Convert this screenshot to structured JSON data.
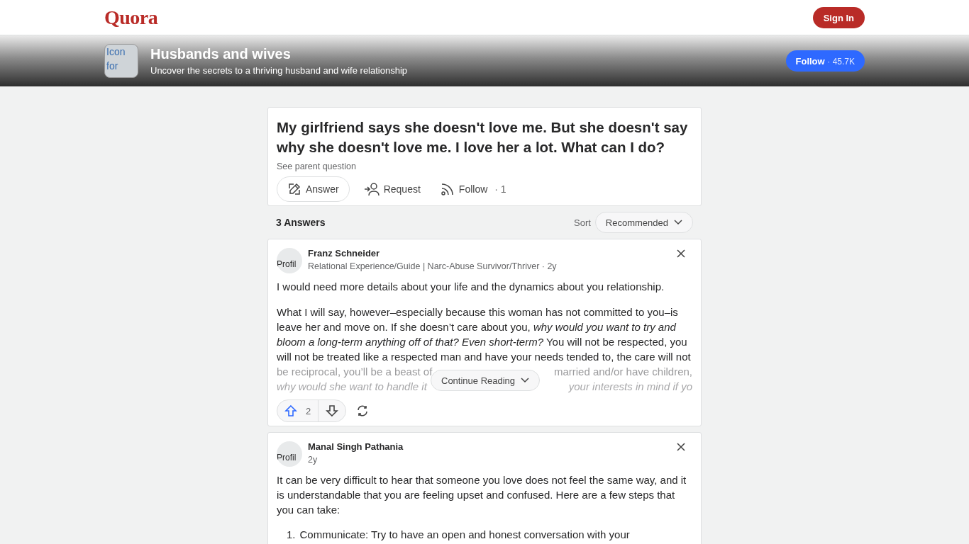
{
  "header": {
    "logo": "Quora",
    "sign_in": "Sign In"
  },
  "space": {
    "icon_alt": "Icon for",
    "name": "Husbands and wives",
    "tagline": "Uncover the secrets to a thriving husband and wife relationship",
    "follow": "Follow",
    "follow_count": "· 45.7K"
  },
  "question": {
    "title": "My girlfriend says she doesn't love me. But she doesn't say why she doesn't love me. I love her a lot. What can I do?",
    "parent_link": "See parent question",
    "actions": [
      {
        "kind": "answer",
        "label": "Answer"
      },
      {
        "kind": "request",
        "label": "Request"
      },
      {
        "kind": "follow",
        "label": "Follow",
        "count": "· 1"
      }
    ]
  },
  "answers_header": {
    "count": "3 Answers",
    "sort_label": "Sort",
    "sort_value": "Recommended"
  },
  "answers": [
    {
      "avatar_alt": "Profil",
      "author": "Franz Schneider",
      "credential": "Relational Experience/Guide | Narc-Abuse Survivor/Thriver · 2y",
      "paragraphs": [
        "I would need more details about your life and the dynamics about you relationship.",
        "What I will say, however–especially because this woman has not committed to you–is leave her and move on. If she doesn’t care about you, *why would you want to try and bloom a long-term anything off of that? Even short-term?* You will not be respected, you will not be treated like a respected man and have your needs tended to, the care will not"
      ],
      "faded_lines": [
        {
          "left": "be reciprocal, you’ll be a beast of",
          "right": "married and/or have children,",
          "italic": false
        },
        {
          "left": "why would she want to handle it",
          "right": "your interests in mind if yo",
          "italic": true
        }
      ],
      "continue": "Continue Reading",
      "upvotes": "2"
    },
    {
      "avatar_alt": "Profil",
      "author": "Manal Singh Pathania",
      "credential": "2y",
      "paragraphs": [
        "It can be very difficult to hear that someone you love does not feel the same way, and it is understandable that you are feeling upset and confused. Here are a few steps that you can take:"
      ],
      "list": [
        {
          "marker": "1.",
          "text": "Communicate: Try to have an open and honest conversation with your"
        }
      ]
    }
  ]
}
